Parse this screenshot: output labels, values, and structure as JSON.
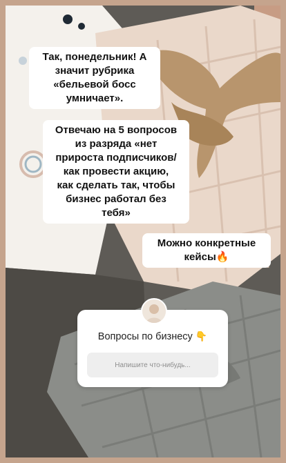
{
  "story": {
    "captions": [
      "Так, понедельник! А\nзначит рубрика\n«бельевой босс\nумничает».",
      "Отвечаю на 5 вопросов\nиз разряда «нет\nприроста подписчиков/\nкак провести акцию,\nкак сделать так, чтобы\nбизнес работал без\nтебя»",
      "Можно конкретные\nкейсы"
    ],
    "fire_emoji": "🔥"
  },
  "question_sticker": {
    "title": "Вопросы по бизнесу",
    "pointing_emoji": "👇",
    "placeholder": "Напишите что-нибудь..."
  },
  "colors": {
    "frame": "#c5a48d",
    "pink_blanket": "#e8d6c7",
    "ribbon": "#b9946a",
    "grey_blanket": "#8c8e8a",
    "card": "#ffffff",
    "input": "#eeeeee"
  }
}
